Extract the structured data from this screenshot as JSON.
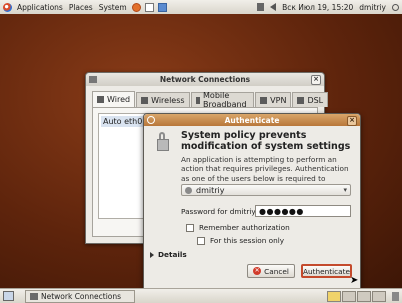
{
  "top_panel": {
    "menus": [
      "Applications",
      "Places",
      "System"
    ],
    "clock": "Вск Июл 19, 15:20",
    "user": "dmitriy"
  },
  "network_window": {
    "title": "Network Connections",
    "close_glyph": "×",
    "tabs": [
      "Wired",
      "Wireless",
      "Mobile Broadband",
      "VPN",
      "DSL"
    ],
    "connection": "Auto eth0"
  },
  "auth_dialog": {
    "title": "Authenticate",
    "close_glyph": "×",
    "heading": "System policy prevents modification of system settings",
    "body": "An application is attempting to perform an action that requires privileges. Authentication as one of the users below is required to perform this action.",
    "selected_user": "dmitriy",
    "password_label": "Password for dmitriy:",
    "password_value": "●●●●●●",
    "remember_label": "Remember authorization",
    "session_label": "For this session only",
    "details_label": "Details",
    "cancel_label": "Cancel",
    "authenticate_label": "Authenticate"
  },
  "bottom_panel": {
    "task_label": "Network Connections"
  },
  "colors": {
    "desktop": "#6b2c12",
    "auth_titlebar": "#b8773a",
    "focus_border": "#c44a2c"
  }
}
